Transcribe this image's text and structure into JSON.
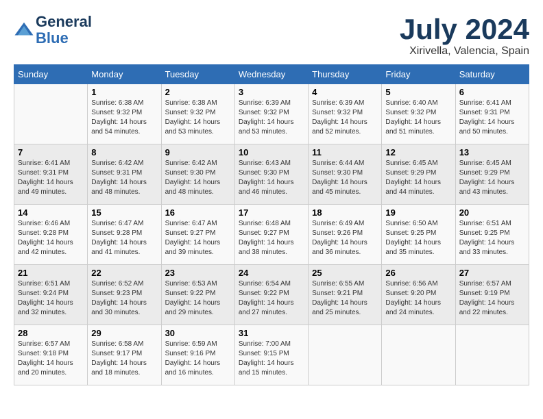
{
  "header": {
    "logo_line1": "General",
    "logo_line2": "Blue",
    "month_title": "July 2024",
    "location": "Xirivella, Valencia, Spain"
  },
  "weekdays": [
    "Sunday",
    "Monday",
    "Tuesday",
    "Wednesday",
    "Thursday",
    "Friday",
    "Saturday"
  ],
  "rows": [
    [
      {
        "day": "",
        "sunrise": "",
        "sunset": "",
        "daylight": ""
      },
      {
        "day": "1",
        "sunrise": "Sunrise: 6:38 AM",
        "sunset": "Sunset: 9:32 PM",
        "daylight": "Daylight: 14 hours and 54 minutes."
      },
      {
        "day": "2",
        "sunrise": "Sunrise: 6:38 AM",
        "sunset": "Sunset: 9:32 PM",
        "daylight": "Daylight: 14 hours and 53 minutes."
      },
      {
        "day": "3",
        "sunrise": "Sunrise: 6:39 AM",
        "sunset": "Sunset: 9:32 PM",
        "daylight": "Daylight: 14 hours and 53 minutes."
      },
      {
        "day": "4",
        "sunrise": "Sunrise: 6:39 AM",
        "sunset": "Sunset: 9:32 PM",
        "daylight": "Daylight: 14 hours and 52 minutes."
      },
      {
        "day": "5",
        "sunrise": "Sunrise: 6:40 AM",
        "sunset": "Sunset: 9:32 PM",
        "daylight": "Daylight: 14 hours and 51 minutes."
      },
      {
        "day": "6",
        "sunrise": "Sunrise: 6:41 AM",
        "sunset": "Sunset: 9:31 PM",
        "daylight": "Daylight: 14 hours and 50 minutes."
      }
    ],
    [
      {
        "day": "7",
        "sunrise": "Sunrise: 6:41 AM",
        "sunset": "Sunset: 9:31 PM",
        "daylight": "Daylight: 14 hours and 49 minutes."
      },
      {
        "day": "8",
        "sunrise": "Sunrise: 6:42 AM",
        "sunset": "Sunset: 9:31 PM",
        "daylight": "Daylight: 14 hours and 48 minutes."
      },
      {
        "day": "9",
        "sunrise": "Sunrise: 6:42 AM",
        "sunset": "Sunset: 9:30 PM",
        "daylight": "Daylight: 14 hours and 48 minutes."
      },
      {
        "day": "10",
        "sunrise": "Sunrise: 6:43 AM",
        "sunset": "Sunset: 9:30 PM",
        "daylight": "Daylight: 14 hours and 46 minutes."
      },
      {
        "day": "11",
        "sunrise": "Sunrise: 6:44 AM",
        "sunset": "Sunset: 9:30 PM",
        "daylight": "Daylight: 14 hours and 45 minutes."
      },
      {
        "day": "12",
        "sunrise": "Sunrise: 6:45 AM",
        "sunset": "Sunset: 9:29 PM",
        "daylight": "Daylight: 14 hours and 44 minutes."
      },
      {
        "day": "13",
        "sunrise": "Sunrise: 6:45 AM",
        "sunset": "Sunset: 9:29 PM",
        "daylight": "Daylight: 14 hours and 43 minutes."
      }
    ],
    [
      {
        "day": "14",
        "sunrise": "Sunrise: 6:46 AM",
        "sunset": "Sunset: 9:28 PM",
        "daylight": "Daylight: 14 hours and 42 minutes."
      },
      {
        "day": "15",
        "sunrise": "Sunrise: 6:47 AM",
        "sunset": "Sunset: 9:28 PM",
        "daylight": "Daylight: 14 hours and 41 minutes."
      },
      {
        "day": "16",
        "sunrise": "Sunrise: 6:47 AM",
        "sunset": "Sunset: 9:27 PM",
        "daylight": "Daylight: 14 hours and 39 minutes."
      },
      {
        "day": "17",
        "sunrise": "Sunrise: 6:48 AM",
        "sunset": "Sunset: 9:27 PM",
        "daylight": "Daylight: 14 hours and 38 minutes."
      },
      {
        "day": "18",
        "sunrise": "Sunrise: 6:49 AM",
        "sunset": "Sunset: 9:26 PM",
        "daylight": "Daylight: 14 hours and 36 minutes."
      },
      {
        "day": "19",
        "sunrise": "Sunrise: 6:50 AM",
        "sunset": "Sunset: 9:25 PM",
        "daylight": "Daylight: 14 hours and 35 minutes."
      },
      {
        "day": "20",
        "sunrise": "Sunrise: 6:51 AM",
        "sunset": "Sunset: 9:25 PM",
        "daylight": "Daylight: 14 hours and 33 minutes."
      }
    ],
    [
      {
        "day": "21",
        "sunrise": "Sunrise: 6:51 AM",
        "sunset": "Sunset: 9:24 PM",
        "daylight": "Daylight: 14 hours and 32 minutes."
      },
      {
        "day": "22",
        "sunrise": "Sunrise: 6:52 AM",
        "sunset": "Sunset: 9:23 PM",
        "daylight": "Daylight: 14 hours and 30 minutes."
      },
      {
        "day": "23",
        "sunrise": "Sunrise: 6:53 AM",
        "sunset": "Sunset: 9:22 PM",
        "daylight": "Daylight: 14 hours and 29 minutes."
      },
      {
        "day": "24",
        "sunrise": "Sunrise: 6:54 AM",
        "sunset": "Sunset: 9:22 PM",
        "daylight": "Daylight: 14 hours and 27 minutes."
      },
      {
        "day": "25",
        "sunrise": "Sunrise: 6:55 AM",
        "sunset": "Sunset: 9:21 PM",
        "daylight": "Daylight: 14 hours and 25 minutes."
      },
      {
        "day": "26",
        "sunrise": "Sunrise: 6:56 AM",
        "sunset": "Sunset: 9:20 PM",
        "daylight": "Daylight: 14 hours and 24 minutes."
      },
      {
        "day": "27",
        "sunrise": "Sunrise: 6:57 AM",
        "sunset": "Sunset: 9:19 PM",
        "daylight": "Daylight: 14 hours and 22 minutes."
      }
    ],
    [
      {
        "day": "28",
        "sunrise": "Sunrise: 6:57 AM",
        "sunset": "Sunset: 9:18 PM",
        "daylight": "Daylight: 14 hours and 20 minutes."
      },
      {
        "day": "29",
        "sunrise": "Sunrise: 6:58 AM",
        "sunset": "Sunset: 9:17 PM",
        "daylight": "Daylight: 14 hours and 18 minutes."
      },
      {
        "day": "30",
        "sunrise": "Sunrise: 6:59 AM",
        "sunset": "Sunset: 9:16 PM",
        "daylight": "Daylight: 14 hours and 16 minutes."
      },
      {
        "day": "31",
        "sunrise": "Sunrise: 7:00 AM",
        "sunset": "Sunset: 9:15 PM",
        "daylight": "Daylight: 14 hours and 15 minutes."
      },
      {
        "day": "",
        "sunrise": "",
        "sunset": "",
        "daylight": ""
      },
      {
        "day": "",
        "sunrise": "",
        "sunset": "",
        "daylight": ""
      },
      {
        "day": "",
        "sunrise": "",
        "sunset": "",
        "daylight": ""
      }
    ]
  ]
}
